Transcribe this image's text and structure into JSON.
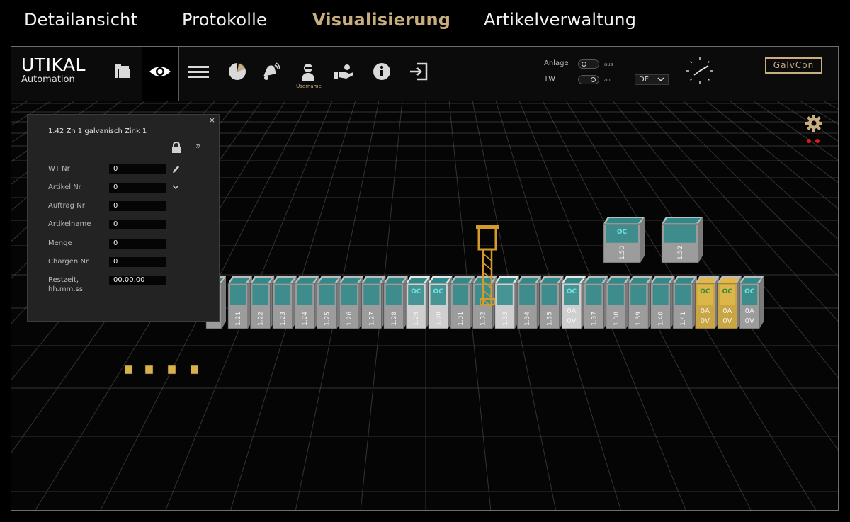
{
  "nav": {
    "tabs": [
      {
        "label": "Detailansicht",
        "active": false
      },
      {
        "label": "Protokolle",
        "active": false
      },
      {
        "label": "Visualisierung",
        "active": true
      },
      {
        "label": "Artikelverwaltung",
        "active": false
      }
    ]
  },
  "brand": {
    "name": "UTIKAL",
    "sub": "Automation"
  },
  "toolbar": {
    "icons": [
      "folder-icon",
      "eye-icon",
      "menu-icon",
      "pie-chart-icon",
      "alarm-bell-icon",
      "user-icon",
      "hand-coin-icon",
      "info-icon",
      "logout-icon"
    ],
    "username": "Username",
    "switches": [
      {
        "label": "Anlage",
        "state": "aus"
      },
      {
        "label": "TW",
        "state": "an"
      }
    ],
    "language": "DE",
    "logo_button": "GalvCon"
  },
  "colors": {
    "accent": "#c8ad7f",
    "tank_water": "#2f8a8a",
    "tank_gold": "#e0b84a",
    "tank_body": "#9c9c9c",
    "crane": "#d49a2a",
    "status_dot": "#e01818"
  },
  "detail_panel": {
    "title": "1.42 Zn 1 galvanisch Zink 1",
    "close": "×",
    "expand": "»",
    "fields": [
      {
        "label": "WT Nr",
        "value": "0"
      },
      {
        "label": "Artikel Nr",
        "value": "0"
      },
      {
        "label": "Auftrag Nr",
        "value": "0"
      },
      {
        "label": "Artikelname",
        "value": "0"
      },
      {
        "label": "Menge",
        "value": "0"
      },
      {
        "label": "Chargen Nr",
        "value": "0"
      },
      {
        "label": "Restzeit,\nhh.mm.ss",
        "value": "00.00.00"
      }
    ]
  },
  "scene": {
    "front_row": [
      {
        "id": "1.21"
      },
      {
        "id": "1.22"
      },
      {
        "id": "1.23"
      },
      {
        "id": "1.24"
      },
      {
        "id": "1.25"
      },
      {
        "id": "1.26"
      },
      {
        "id": "1.27"
      },
      {
        "id": "1.28"
      },
      {
        "id": "1.29",
        "highlight": true,
        "tag": "OC"
      },
      {
        "id": "1.30",
        "highlight": true,
        "tag": "OC"
      },
      {
        "id": "1.31"
      },
      {
        "id": "1.32"
      },
      {
        "id": "1.33",
        "highlight": true
      },
      {
        "id": "1.34"
      },
      {
        "id": "1.35"
      },
      {
        "id": "0A\n0V",
        "highlight": true,
        "tag": "OC"
      },
      {
        "id": "1.37"
      },
      {
        "id": "1.38"
      },
      {
        "id": "1.39"
      },
      {
        "id": "1.40"
      },
      {
        "id": "1.41"
      },
      {
        "id": "0A\n0V",
        "gold": true,
        "tag": "OC"
      },
      {
        "id": "0A\n0V",
        "gold": true,
        "tag": "OC"
      },
      {
        "id": "0A\n0V",
        "tag": "OC"
      }
    ],
    "back_row": [
      {
        "id": "1.50",
        "tag": "OC"
      },
      {
        "id": "1.52"
      }
    ]
  }
}
